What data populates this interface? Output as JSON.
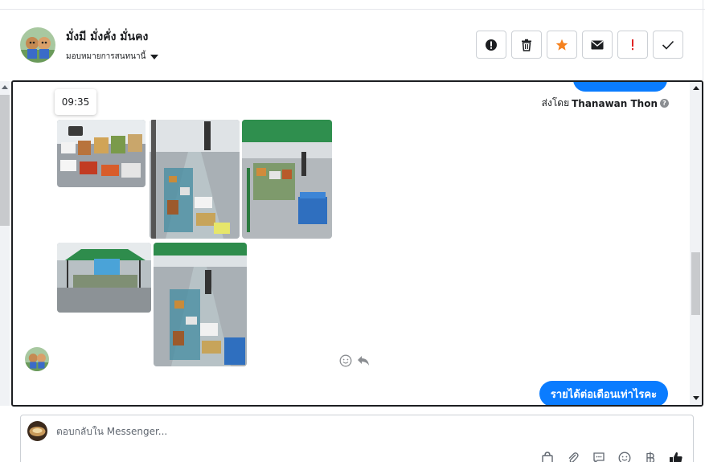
{
  "header": {
    "name": "มั่งมี มั่งคั่ง มั่นคง",
    "assign_label": "มอบหมายการสนทนานี้",
    "actions": [
      {
        "name": "spam-alert-button",
        "icon": "alert-circle-icon"
      },
      {
        "name": "delete-button",
        "icon": "trash-icon"
      },
      {
        "name": "star-button",
        "icon": "star-icon"
      },
      {
        "name": "mark-unread-button",
        "icon": "envelope-icon"
      },
      {
        "name": "important-button",
        "icon": "exclamation-icon"
      },
      {
        "name": "done-button",
        "icon": "checkmark-icon"
      }
    ]
  },
  "chat": {
    "timestamp": "09:35",
    "sent_by_prefix": "ส่งโดย",
    "sent_by_name": "Thanawan Thon",
    "last_message": "รายได้ต่อเดือนเท่าไรคะ",
    "photo_count": 5
  },
  "reply": {
    "placeholder": "ตอบกลับใน Messenger..."
  },
  "colors": {
    "accent": "#0a7cff",
    "star": "#f5821f",
    "important": "#e02424"
  }
}
